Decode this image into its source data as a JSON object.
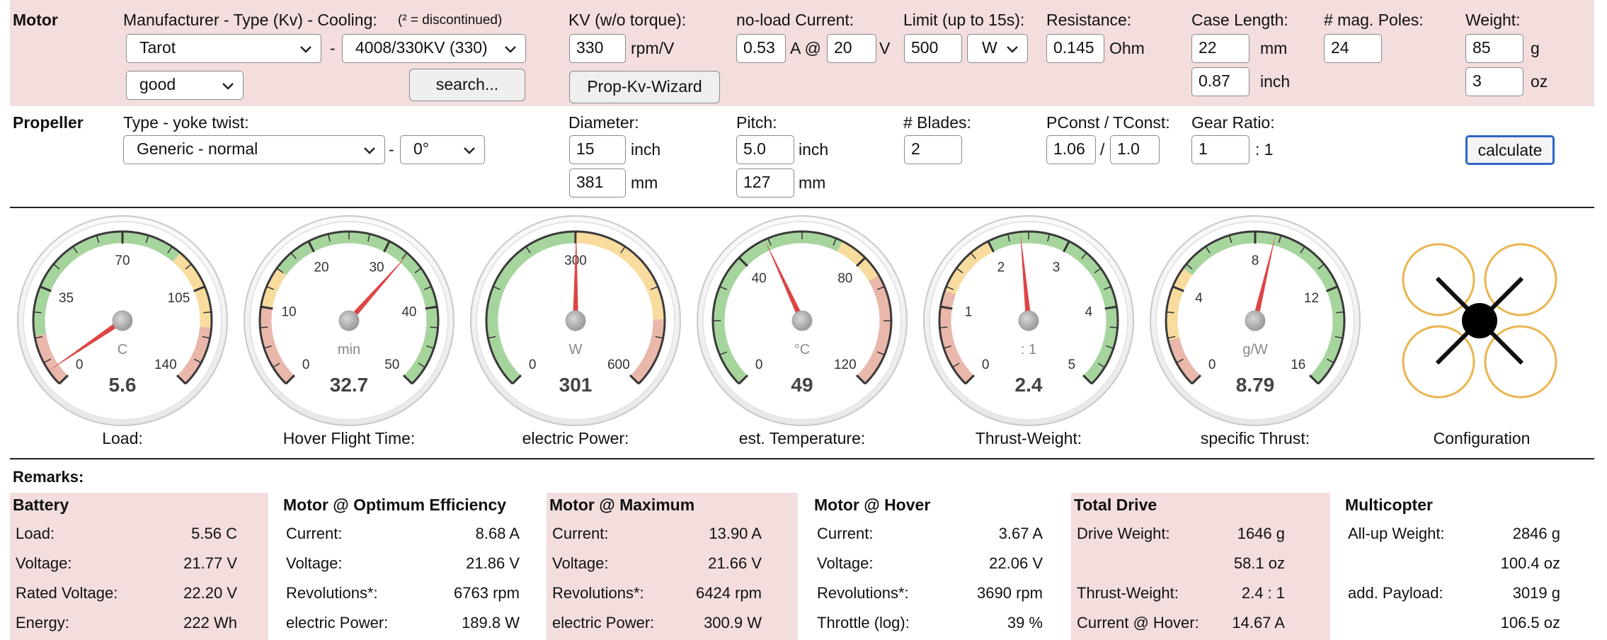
{
  "motor": {
    "section_label": "Motor",
    "mtc_label": "Manufacturer - Type (Kv) - Cooling:",
    "discontinued_note": "(² = discontinued)",
    "manufacturer": "Tarot",
    "dash": "-",
    "type": "4008/330KV (330)",
    "cooling": "good",
    "search_label": "search...",
    "kv_label": "KV (w/o torque):",
    "kv_value": "330",
    "kv_unit": "rpm/V",
    "wizard_label": "Prop-Kv-Wizard",
    "noload_label": "no-load Current:",
    "noload_current": "0.53",
    "noload_a_at": "A @",
    "noload_voltage": "20",
    "noload_v": "V",
    "limit_label": "Limit (up to 15s):",
    "limit_value": "500",
    "limit_unit": "W",
    "resistance_label": "Resistance:",
    "resistance_value": "0.145",
    "resistance_unit": "Ohm",
    "case_label": "Case Length:",
    "case_mm": "22",
    "case_mm_unit": "mm",
    "case_inch": "0.87",
    "case_inch_unit": "inch",
    "poles_label": "# mag. Poles:",
    "poles_value": "24",
    "weight_label": "Weight:",
    "weight_g": "85",
    "weight_g_unit": "g",
    "weight_oz": "3",
    "weight_oz_unit": "oz"
  },
  "propeller": {
    "section_label": "Propeller",
    "type_label": "Type - yoke twist:",
    "type": "Generic - normal",
    "dash": "-",
    "twist": "0°",
    "diameter_label": "Diameter:",
    "diameter_inch": "15",
    "diameter_inch_unit": "inch",
    "diameter_mm": "381",
    "diameter_mm_unit": "mm",
    "pitch_label": "Pitch:",
    "pitch_inch": "5.0",
    "pitch_inch_unit": "inch",
    "pitch_mm": "127",
    "pitch_mm_unit": "mm",
    "blades_label": "# Blades:",
    "blades_value": "2",
    "pconst_label": "PConst / TConst:",
    "pconst": "1.06",
    "slash": "/",
    "tconst": "1.0",
    "gear_label": "Gear Ratio:",
    "gear_value": "1",
    "gear_suffix": ": 1",
    "calculate_label": "calculate"
  },
  "gauges": [
    {
      "label": "Load:",
      "unit": "C",
      "value": "5.6",
      "value_num": 5.6,
      "min": 0,
      "max": 140,
      "ticks": [
        "0",
        "35",
        "70",
        "105",
        "140"
      ],
      "bands": [
        [
          "r",
          0,
          0.13
        ],
        [
          "g",
          0.13,
          0.65
        ],
        [
          "y",
          0.65,
          0.85
        ],
        [
          "r",
          0.85,
          1
        ]
      ]
    },
    {
      "label": "Hover Flight Time:",
      "unit": "min",
      "value": "32.7",
      "value_num": 32.7,
      "min": 0,
      "max": 50,
      "ticks": [
        "0",
        "10",
        "20",
        "30",
        "40",
        "50"
      ],
      "bands": [
        [
          "r",
          0,
          0.2
        ],
        [
          "y",
          0.2,
          0.3
        ],
        [
          "g",
          0.3,
          1
        ]
      ]
    },
    {
      "label": "electric Power:",
      "unit": "W",
      "value": "301",
      "value_num": 301,
      "min": 0,
      "max": 600,
      "ticks": [
        "0",
        "300",
        "600"
      ],
      "bands": [
        [
          "g",
          0,
          0.5
        ],
        [
          "y",
          0.5,
          0.83
        ],
        [
          "r",
          0.83,
          1
        ]
      ]
    },
    {
      "label": "est. Temperature:",
      "unit": "°C",
      "value": "49",
      "value_num": 49,
      "min": 0,
      "max": 120,
      "ticks": [
        "0",
        "40",
        "80",
        "120"
      ],
      "bands": [
        [
          "g",
          0,
          0.6
        ],
        [
          "y",
          0.6,
          0.72
        ],
        [
          "r",
          0.72,
          1
        ]
      ]
    },
    {
      "label": "Thrust-Weight:",
      "unit": ": 1",
      "value": "2.4",
      "value_num": 2.4,
      "min": 0,
      "max": 5,
      "ticks": [
        "0",
        "1",
        "2",
        "3",
        "4",
        "5"
      ],
      "bands": [
        [
          "r",
          0,
          0.24
        ],
        [
          "y",
          0.24,
          0.4
        ],
        [
          "g",
          0.4,
          1
        ]
      ]
    },
    {
      "label": "specific Thrust:",
      "unit": "g/W",
      "value": "8.79",
      "value_num": 8.79,
      "min": 0,
      "max": 16,
      "ticks": [
        "0",
        "4",
        "8",
        "12",
        "16"
      ],
      "bands": [
        [
          "r",
          0,
          0.12
        ],
        [
          "y",
          0.12,
          0.3
        ],
        [
          "g",
          0.3,
          1
        ]
      ]
    }
  ],
  "configuration": {
    "label": "Configuration"
  },
  "remarks": {
    "label": "Remarks:",
    "battery": {
      "title": "Battery",
      "rows": [
        {
          "k": "Load:",
          "v": "5.56 C"
        },
        {
          "k": "Voltage:",
          "v": "21.77 V"
        },
        {
          "k": "Rated Voltage:",
          "v": "22.20 V"
        },
        {
          "k": "Energy:",
          "v": "222 Wh"
        }
      ]
    },
    "opt_eff": {
      "title": "Motor @ Optimum Efficiency",
      "rows": [
        {
          "k": "Current:",
          "v": "8.68 A"
        },
        {
          "k": "Voltage:",
          "v": "21.86 V"
        },
        {
          "k": "Revolutions*:",
          "v": "6763 rpm"
        },
        {
          "k": "electric Power:",
          "v": "189.8 W"
        }
      ]
    },
    "maximum": {
      "title": "Motor @ Maximum",
      "rows": [
        {
          "k": "Current:",
          "v": "13.90 A"
        },
        {
          "k": "Voltage:",
          "v": "21.66 V"
        },
        {
          "k": "Revolutions*:",
          "v": "6424 rpm"
        },
        {
          "k": "electric Power:",
          "v": "300.9 W"
        }
      ]
    },
    "hover": {
      "title": "Motor @ Hover",
      "rows": [
        {
          "k": "Current:",
          "v": "3.67 A"
        },
        {
          "k": "Voltage:",
          "v": "22.06 V"
        },
        {
          "k": "Revolutions*:",
          "v": "3690 rpm"
        },
        {
          "k": "Throttle (log):",
          "v": "39 %"
        }
      ]
    },
    "total_drive": {
      "title": "Total Drive",
      "rows": [
        {
          "k": "Drive Weight:",
          "v": "1646 g"
        },
        {
          "k": "",
          "v": "58.1 oz"
        },
        {
          "k": "Thrust-Weight:",
          "v": "2.4 : 1"
        },
        {
          "k": "Current @ Hover:",
          "v": "14.67 A"
        }
      ]
    },
    "multicopter": {
      "title": "Multicopter",
      "rows": [
        {
          "k": "All-up Weight:",
          "v": "2846 g"
        },
        {
          "k": "",
          "v": "100.4 oz"
        },
        {
          "k": "add. Payload:",
          "v": "3019 g"
        },
        {
          "k": "",
          "v": "106.5 oz"
        }
      ]
    }
  }
}
